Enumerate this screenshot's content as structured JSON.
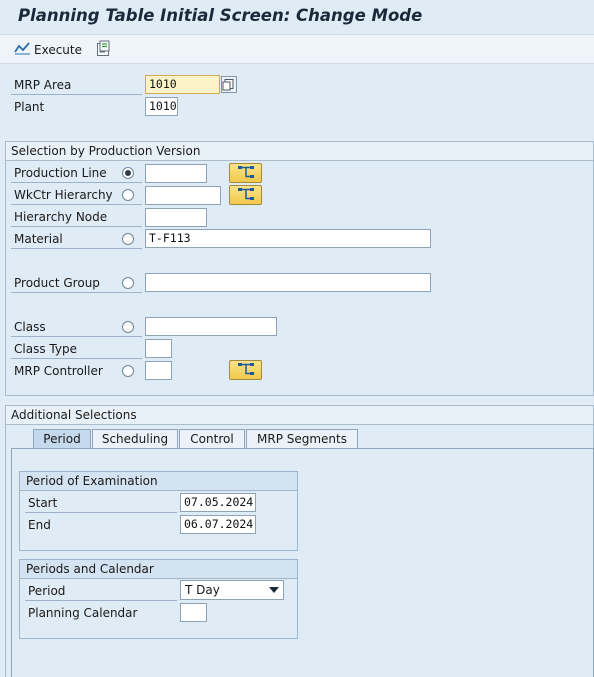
{
  "title": "Planning Table Initial Screen: Change Mode",
  "toolbar": {
    "execute_label": "Execute"
  },
  "header_fields": {
    "mrp_area_label": "MRP Area",
    "mrp_area_value": "1010",
    "plant_label": "Plant",
    "plant_value": "1010"
  },
  "selection": {
    "title": "Selection by Production Version",
    "production_line_label": "Production Line",
    "production_line_value": "",
    "wkctr_hierarchy_label": "WkCtr Hierarchy",
    "wkctr_hierarchy_value": "",
    "hierarchy_node_label": "Hierarchy Node",
    "hierarchy_node_value": "",
    "material_label": "Material",
    "material_value": "T-F113",
    "product_group_label": "Product Group",
    "product_group_value": "",
    "class_label": "Class",
    "class_value": "",
    "class_type_label": "Class Type",
    "class_type_value": "",
    "mrp_controller_label": "MRP Controller",
    "mrp_controller_value": "",
    "selected_option": "production_line"
  },
  "additional": {
    "title": "Additional Selections",
    "tabs": [
      "Period",
      "Scheduling",
      "Control",
      "MRP Segments"
    ],
    "active_tab": "Period",
    "period_of_examination": {
      "title": "Period of Examination",
      "start_label": "Start",
      "start_value": "07.05.2024",
      "end_label": "End",
      "end_value": "06.07.2024"
    },
    "periods_calendar": {
      "title": "Periods and Calendar",
      "period_label": "Period",
      "period_value": "T Day",
      "planning_calendar_label": "Planning Calendar",
      "planning_calendar_value": ""
    }
  },
  "colors": {
    "background": "#dfebf5",
    "required_field": "#fcf4c8",
    "hierarchy_button": "#f1c94b"
  }
}
